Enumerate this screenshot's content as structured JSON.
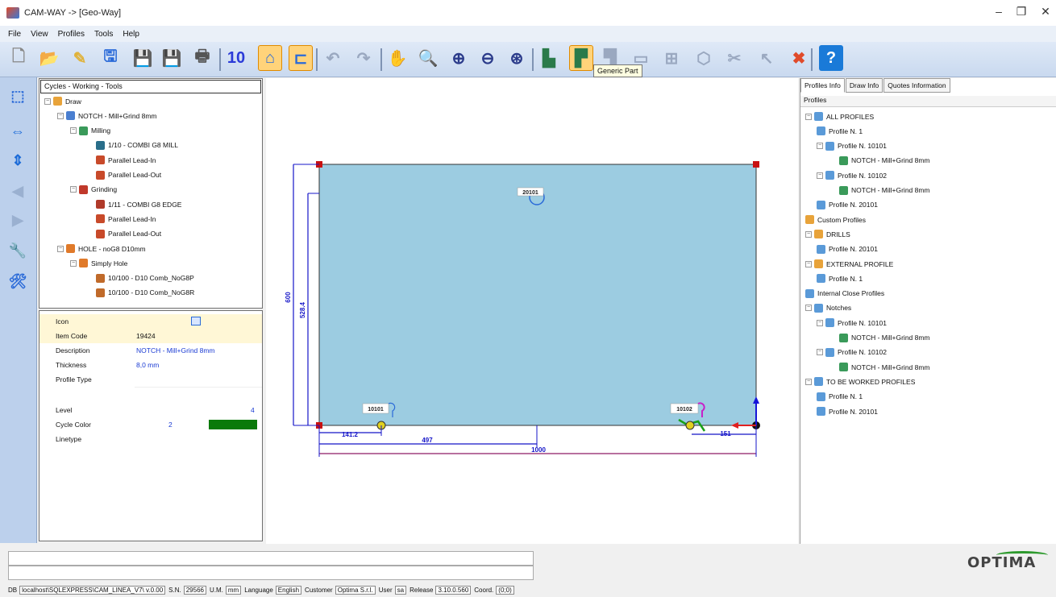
{
  "window": {
    "title": "CAM-WAY -> [Geo-Way]",
    "controls": [
      "–",
      "❐",
      "✕"
    ]
  },
  "menu": [
    "File",
    "View",
    "Profiles",
    "Tools",
    "Help"
  ],
  "toolbar": {
    "tooltip": "Generic Part",
    "items": [
      {
        "name": "new-icon",
        "glyph": "🗋"
      },
      {
        "name": "open-folder-icon",
        "glyph": "📂"
      },
      {
        "name": "edit-icon",
        "glyph": "✎"
      },
      {
        "name": "save-as-icon",
        "glyph": "🖫"
      },
      {
        "name": "save-icon",
        "glyph": "💾"
      },
      {
        "name": "save-all-icon",
        "glyph": "💾"
      },
      {
        "name": "print-icon",
        "glyph": "🖶"
      },
      {
        "name": "ten-icon",
        "glyph": "10"
      },
      {
        "name": "profile-shape-icon",
        "glyph": "⌂"
      },
      {
        "name": "notch-shape-icon",
        "glyph": "⊏"
      },
      {
        "name": "undo-icon",
        "glyph": "↶"
      },
      {
        "name": "redo-icon",
        "glyph": "↷"
      },
      {
        "name": "pan-hand-icon",
        "glyph": "✋"
      },
      {
        "name": "zoom-window-icon",
        "glyph": "🔍"
      },
      {
        "name": "zoom-in-icon",
        "glyph": "⊕"
      },
      {
        "name": "zoom-out-icon",
        "glyph": "⊖"
      },
      {
        "name": "zoom-all-icon",
        "glyph": "⊛"
      },
      {
        "name": "part-icon",
        "glyph": "▙"
      },
      {
        "name": "generic-part-icon",
        "glyph": "▛"
      },
      {
        "name": "copy-part-icon",
        "glyph": "▜"
      },
      {
        "name": "rectangle-icon",
        "glyph": "▭"
      },
      {
        "name": "add-icon",
        "glyph": "⊞"
      },
      {
        "name": "cube-icon",
        "glyph": "⬡"
      },
      {
        "name": "scissors-icon",
        "glyph": "✂"
      },
      {
        "name": "pointer-icon",
        "glyph": "↖"
      },
      {
        "name": "delete-x-icon",
        "glyph": "✖"
      },
      {
        "name": "help-icon",
        "glyph": "?"
      }
    ]
  },
  "left_tools": [
    {
      "name": "select-icon",
      "glyph": "⬚"
    },
    {
      "name": "horizontal-move-icon",
      "glyph": "⇔"
    },
    {
      "name": "vertical-move-icon",
      "glyph": "⇕"
    },
    {
      "name": "left-arrow-icon",
      "glyph": "◀"
    },
    {
      "name": "right-arrow-icon",
      "glyph": "▶"
    },
    {
      "name": "tool-icon",
      "glyph": "🔧"
    },
    {
      "name": "tools-icon",
      "glyph": "🛠"
    }
  ],
  "cycles_panel": {
    "header": "Cycles - Working - Tools",
    "nodes": [
      {
        "label": "Draw",
        "indent": 0,
        "exp": "−",
        "icon": "#e8a33a"
      },
      {
        "label": "NOTCH - Mill+Grind 8mm",
        "indent": 1,
        "exp": "−",
        "icon": "#4a7fd0"
      },
      {
        "label": "Milling",
        "indent": 2,
        "exp": "−",
        "icon": "#3a9a5a"
      },
      {
        "label": "1/10 - COMBI G8 MILL",
        "indent": 4,
        "exp": "",
        "icon": "#2a6e8a"
      },
      {
        "label": "Parallel Lead-In",
        "indent": 4,
        "exp": "",
        "icon": "#c84a2a"
      },
      {
        "label": "Parallel Lead-Out",
        "indent": 4,
        "exp": "",
        "icon": "#c84a2a"
      },
      {
        "label": "Grinding",
        "indent": 2,
        "exp": "−",
        "icon": "#c0392b"
      },
      {
        "label": "1/11 - COMBI G8 EDGE",
        "indent": 4,
        "exp": "",
        "icon": "#b03a2a"
      },
      {
        "label": "Parallel Lead-In",
        "indent": 4,
        "exp": "",
        "icon": "#c84a2a"
      },
      {
        "label": "Parallel Lead-Out",
        "indent": 4,
        "exp": "",
        "icon": "#c84a2a"
      },
      {
        "label": "HOLE - noG8 D10mm",
        "indent": 1,
        "exp": "−",
        "icon": "#e07a2a"
      },
      {
        "label": "Simply Hole",
        "indent": 2,
        "exp": "−",
        "icon": "#e07a2a"
      },
      {
        "label": "10/100 - D10 Comb_NoG8P",
        "indent": 4,
        "exp": "",
        "icon": "#c06a2a"
      },
      {
        "label": "10/100 - D10 Comb_NoG8R",
        "indent": 4,
        "exp": "",
        "icon": "#c06a2a"
      }
    ]
  },
  "properties": {
    "rows": [
      {
        "label": "Icon",
        "value": "",
        "color": "#fff7d6"
      },
      {
        "label": "Item Code",
        "value": "19424",
        "color": "#fff7d6"
      },
      {
        "label": "Description",
        "value": "NOTCH - Mill+Grind 8mm",
        "color": "#ffffff"
      },
      {
        "label": "Thickness",
        "value": "8,0 mm",
        "color": "#ffffff"
      },
      {
        "label": "Profile Type",
        "value": "",
        "color": "#ffffff"
      },
      {
        "label": "Level",
        "value": "4",
        "color": "#ffffff"
      },
      {
        "label": "Cycle Color",
        "value": "2",
        "color": "#ffffff"
      },
      {
        "label": "Linetype",
        "value": "",
        "color": "#ffffff"
      }
    ],
    "cycle_swatch": "#0a7a0a"
  },
  "drawing": {
    "part_fill": "#9ccce1",
    "dim_color": "#1515c8",
    "ref_color": "#e02020",
    "dims": {
      "total_width": "1000",
      "offset_a": "141.2",
      "offset_b": "497",
      "notch_right": "151",
      "height_total": "600",
      "height_inner": "528.4"
    },
    "labels": {
      "hole_tag": "20101",
      "notch_left_tag": "10101",
      "notch_right_tag": "10102"
    }
  },
  "right_panel": {
    "tabs": [
      "Profiles Info",
      "Draw Info",
      "Quotes Information"
    ],
    "header": "Profiles",
    "nodes": [
      {
        "label": "ALL PROFILES",
        "indent": 0,
        "exp": "−",
        "icon": "#5a9ad8"
      },
      {
        "label": "Profile N. 1",
        "indent": 1,
        "exp": "",
        "icon": "#5a9ad8"
      },
      {
        "label": "Profile N. 10101",
        "indent": 1,
        "exp": "−",
        "icon": "#5a9ad8"
      },
      {
        "label": "NOTCH - Mill+Grind 8mm",
        "indent": 3,
        "exp": "",
        "icon": "#3a9a5a"
      },
      {
        "label": "Profile N. 10102",
        "indent": 1,
        "exp": "−",
        "icon": "#5a9ad8"
      },
      {
        "label": "NOTCH - Mill+Grind 8mm",
        "indent": 3,
        "exp": "",
        "icon": "#3a9a5a"
      },
      {
        "label": "Profile N. 20101",
        "indent": 1,
        "exp": "",
        "icon": "#5a9ad8"
      },
      {
        "label": "Custom Profiles",
        "indent": 0,
        "exp": "",
        "icon": "#e8a33a"
      },
      {
        "label": "DRILLS",
        "indent": 0,
        "exp": "−",
        "icon": "#e8a33a"
      },
      {
        "label": "Profile N. 20101",
        "indent": 1,
        "exp": "",
        "icon": "#5a9ad8"
      },
      {
        "label": "EXTERNAL PROFILE",
        "indent": 0,
        "exp": "−",
        "icon": "#e8a33a"
      },
      {
        "label": "Profile N. 1",
        "indent": 1,
        "exp": "",
        "icon": "#5a9ad8"
      },
      {
        "label": "Internal Close Profiles",
        "indent": 0,
        "exp": "",
        "icon": "#5a9ad8"
      },
      {
        "label": "Notches",
        "indent": 0,
        "exp": "−",
        "icon": "#5a9ad8"
      },
      {
        "label": "Profile N. 10101",
        "indent": 1,
        "exp": "−",
        "icon": "#5a9ad8"
      },
      {
        "label": "NOTCH - Mill+Grind 8mm",
        "indent": 3,
        "exp": "",
        "icon": "#3a9a5a"
      },
      {
        "label": "Profile N. 10102",
        "indent": 1,
        "exp": "−",
        "icon": "#5a9ad8"
      },
      {
        "label": "NOTCH - Mill+Grind 8mm",
        "indent": 3,
        "exp": "",
        "icon": "#3a9a5a"
      },
      {
        "label": "TO BE WORKED PROFILES",
        "indent": 0,
        "exp": "−",
        "icon": "#5a9ad8"
      },
      {
        "label": "Profile N. 1",
        "indent": 1,
        "exp": "",
        "icon": "#5a9ad8"
      },
      {
        "label": "Profile N. 20101",
        "indent": 1,
        "exp": "",
        "icon": "#5a9ad8"
      }
    ]
  },
  "logo": "OPTIMA",
  "infobar": [
    {
      "label": "DB",
      "value": "localhost\\SQLEXPRESS\\CAM_LINEA_V7\\ v.0.00"
    },
    {
      "label": "S.N.",
      "value": "29566"
    },
    {
      "label": "U.M.",
      "value": "mm"
    },
    {
      "label": "Language",
      "value": "English"
    },
    {
      "label": "Customer",
      "value": "Optima S.r.l."
    },
    {
      "label": "User",
      "value": "sa"
    },
    {
      "label": "Release",
      "value": "3.10.0.560"
    },
    {
      "label": "Coord.",
      "value": "(0;0)"
    }
  ]
}
